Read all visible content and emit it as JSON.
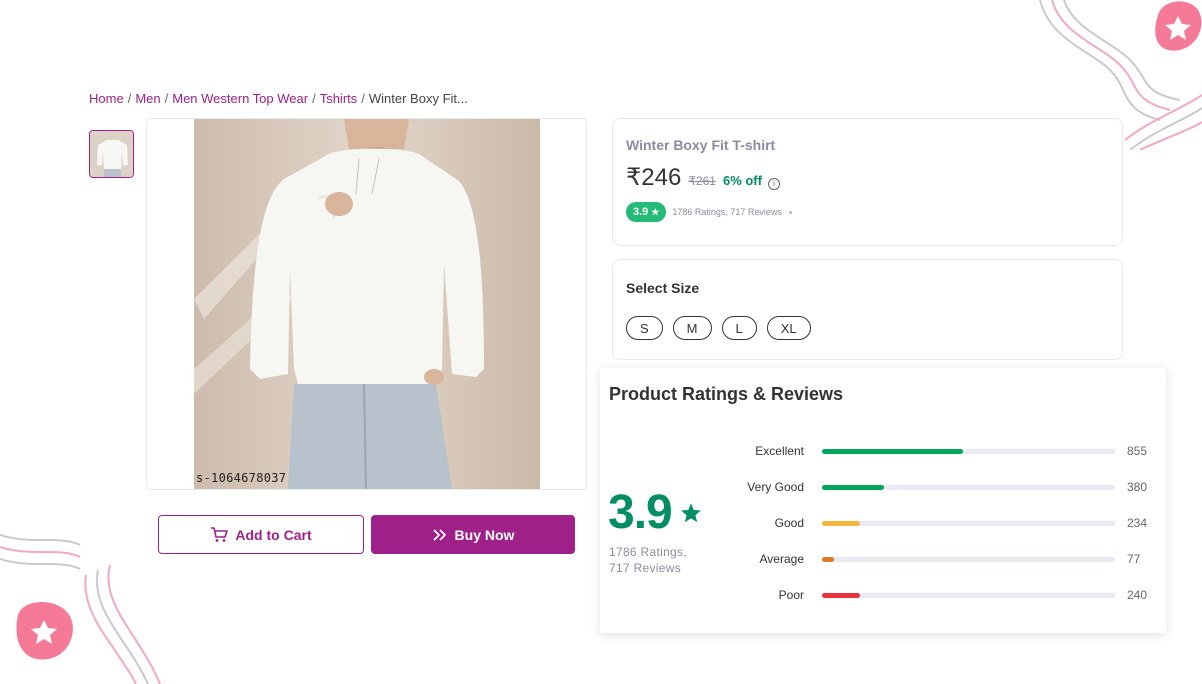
{
  "breadcrumb": {
    "items": [
      "Home",
      "Men",
      "Men Western Top Wear",
      "Tshirts"
    ],
    "current": "Winter Boxy Fit...",
    "separator": "/"
  },
  "product": {
    "image_watermark": "s-1064678037",
    "title": "Winter Boxy Fit T-shirt",
    "price": "₹246",
    "mrp": "₹261",
    "discount": "6% off",
    "info_icon": "i",
    "rating": "3.9",
    "star": "★",
    "ratings_summary": "1786 Ratings, 717 Reviews"
  },
  "actions": {
    "add_to_cart": "Add to Cart",
    "buy_now": "Buy Now"
  },
  "size_selector": {
    "title": "Select Size",
    "sizes": [
      "S",
      "M",
      "L",
      "XL"
    ]
  },
  "reviews": {
    "title": "Product Ratings & Reviews",
    "overall": "3.9",
    "ratings_line": "1786  Ratings,",
    "reviews_line": "717  Reviews",
    "breakdown": [
      {
        "label": "Excellent",
        "count": "855",
        "fraction": 0.48,
        "color": "#00a65c"
      },
      {
        "label": "Very Good",
        "count": "380",
        "fraction": 0.21,
        "color": "#00a65c"
      },
      {
        "label": "Good",
        "count": "234",
        "fraction": 0.13,
        "color": "#f4b63f"
      },
      {
        "label": "Average",
        "count": "77",
        "fraction": 0.04,
        "color": "#e07a26"
      },
      {
        "label": "Poor",
        "count": "240",
        "fraction": 0.13,
        "color": "#e8333f"
      }
    ]
  },
  "colors": {
    "brand": "#9f2089",
    "rating_green": "#038d63",
    "pill_green": "#23bb75",
    "muted_text": "#8b8ba3"
  }
}
